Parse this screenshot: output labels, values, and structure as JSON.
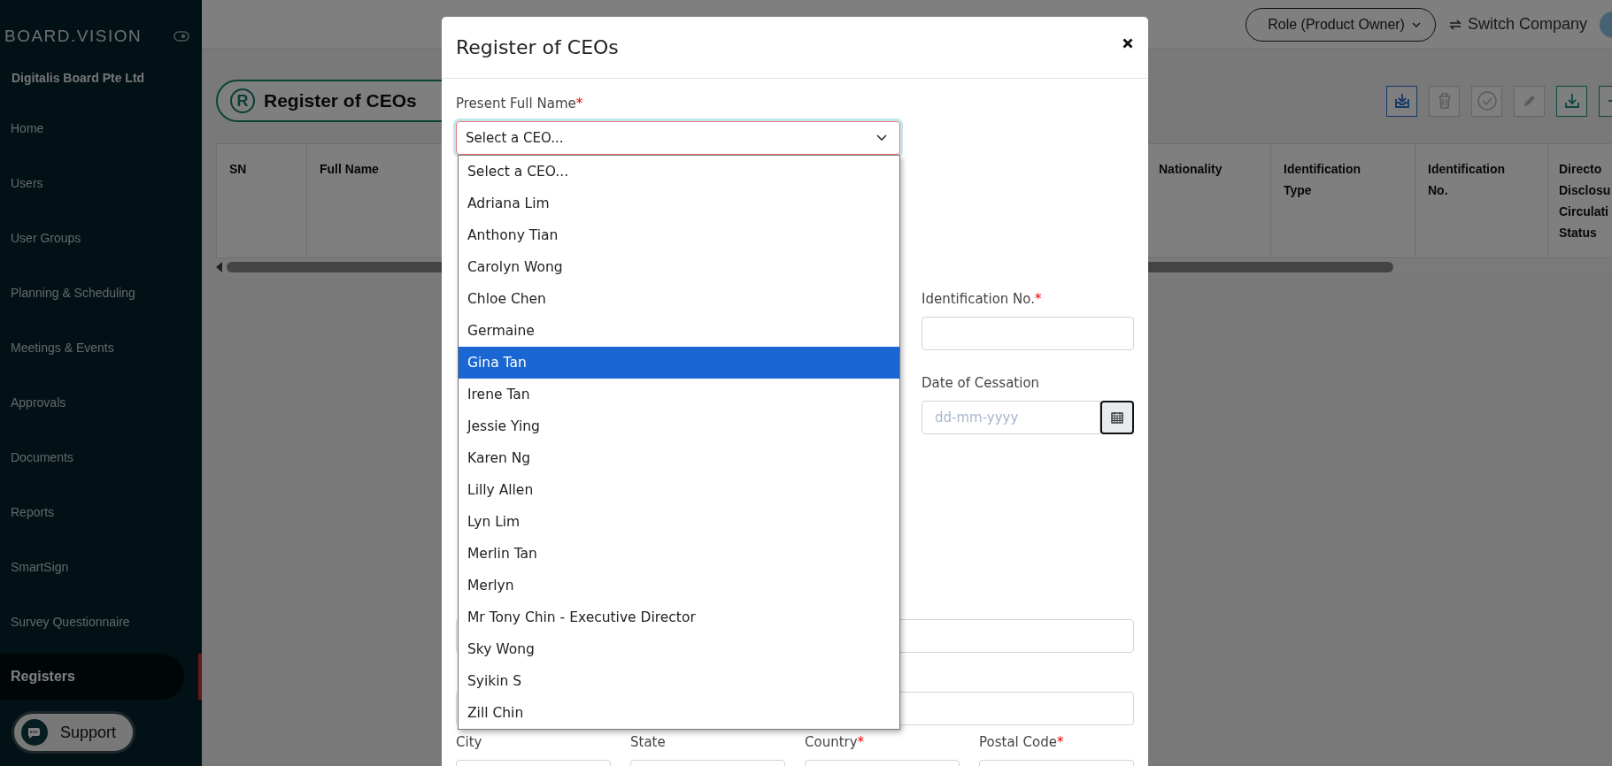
{
  "sidebar": {
    "brand": "BOARD.VISION",
    "company": "Digitalis Board Pte Ltd",
    "items": [
      {
        "label": "Home",
        "selected": false
      },
      {
        "label": "Users",
        "selected": false
      },
      {
        "label": "User Groups",
        "selected": false
      },
      {
        "label": "Planning & Scheduling",
        "selected": false
      },
      {
        "label": "Meetings & Events",
        "selected": false
      },
      {
        "label": "Approvals",
        "selected": false
      },
      {
        "label": "Documents",
        "selected": false
      },
      {
        "label": "Reports",
        "selected": false
      },
      {
        "label": "SmartSign",
        "selected": false
      },
      {
        "label": "Survey Questionnaire",
        "selected": false
      },
      {
        "label": "Registers",
        "selected": true
      }
    ],
    "support_button": "Support"
  },
  "header": {
    "role": "Role (Product Owner)",
    "switch_company": "Switch Company"
  },
  "page": {
    "title_badge": "R",
    "title": "Register of CEOs",
    "toolbar": [
      {
        "kind": "import",
        "disabled": false
      },
      {
        "kind": "delete",
        "disabled": true
      },
      {
        "kind": "approve",
        "disabled": true
      },
      {
        "kind": "edit",
        "disabled": true
      },
      {
        "kind": "download",
        "disabled": false
      },
      {
        "kind": "add",
        "disabled": false
      }
    ],
    "table": {
      "columns": [
        {
          "lines": [
            "SN"
          ]
        },
        {
          "lines": [
            "Full Name"
          ]
        },
        {
          "lines": [
            "Nationality"
          ]
        },
        {
          "lines": [
            "Identification",
            "Type"
          ]
        },
        {
          "lines": [
            "Identification",
            "No."
          ]
        },
        {
          "lines": [
            "Directo",
            "Disclosu",
            "Circulati",
            "Status"
          ]
        }
      ]
    }
  },
  "modal": {
    "title": "Register of CEOs",
    "name_field": {
      "label": "Present Full Name",
      "marker": "*",
      "value": "Select a CEO...",
      "expanded": true,
      "options": [
        {
          "label": "Select a CEO...",
          "highlighted": false
        },
        {
          "label": "Adriana Lim",
          "highlighted": false
        },
        {
          "label": "Anthony Tian",
          "highlighted": false
        },
        {
          "label": "Carolyn Wong",
          "highlighted": false
        },
        {
          "label": "Chloe Chen",
          "highlighted": false
        },
        {
          "label": "Germaine",
          "highlighted": false
        },
        {
          "label": "Gina Tan",
          "highlighted": true
        },
        {
          "label": "Irene Tan",
          "highlighted": false
        },
        {
          "label": "Jessie Ying",
          "highlighted": false
        },
        {
          "label": "Karen Ng",
          "highlighted": false
        },
        {
          "label": "Lilly Allen",
          "highlighted": false
        },
        {
          "label": "Lyn Lim",
          "highlighted": false
        },
        {
          "label": "Merlin Tan",
          "highlighted": false
        },
        {
          "label": "Merlyn",
          "highlighted": false
        },
        {
          "label": "Mr Tony Chin - Executive Director",
          "highlighted": false
        },
        {
          "label": "Sky Wong",
          "highlighted": false
        },
        {
          "label": "Syikin S",
          "highlighted": false
        },
        {
          "label": "Zill Chin",
          "highlighted": false
        }
      ]
    },
    "right_fields": [
      {
        "kind": "text",
        "label": "Identification No.",
        "marker": "*"
      },
      {
        "kind": "date",
        "label": "Date of Cessation",
        "placeholder": "dd-mm-yyyy"
      }
    ],
    "address_fields": [
      {
        "label": "City"
      },
      {
        "label": "State"
      },
      {
        "label": "Country",
        "marker": "*"
      },
      {
        "label": "Postal Code",
        "marker": "*"
      }
    ]
  }
}
